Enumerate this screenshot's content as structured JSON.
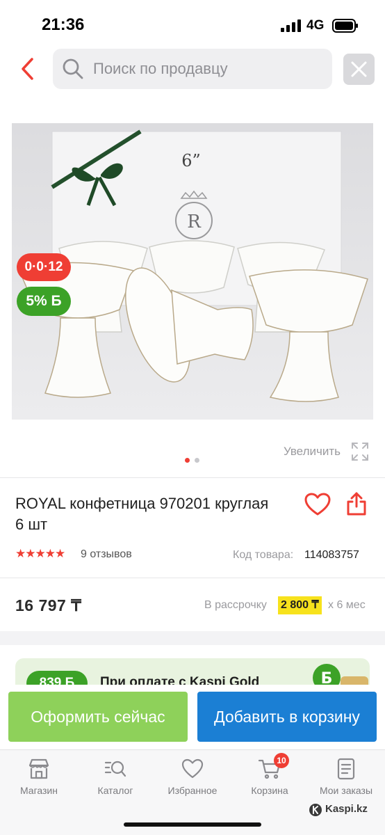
{
  "status_bar": {
    "time": "21:36",
    "network": "4G"
  },
  "search": {
    "placeholder": "Поиск по продавцу"
  },
  "product": {
    "badge_installment": "0·0·12",
    "badge_bonus": "5% Б",
    "image_pagination": {
      "current": 1,
      "total": 2
    },
    "zoom_label": "Увеличить",
    "title": "ROYAL конфетница 970201 круглая 6 шт",
    "rating_stars": 5,
    "reviews": "9 отзывов",
    "sku_label": "Код товара:",
    "sku_value": "114083757",
    "price": "16 797 ₸",
    "installment_label": "В рассрочку",
    "installment_amount": "2 800 ₸",
    "installment_term": "х 6 мес",
    "image_text": "6”",
    "logo_letter": "R"
  },
  "promo": {
    "badge": "839 Б",
    "text": "При оплате с Kaspi Gold"
  },
  "actions": {
    "buy_now": "Оформить сейчас",
    "add_to_cart": "Добавить в корзину"
  },
  "nav": {
    "items": [
      {
        "label": "Магазин",
        "icon": "store-icon"
      },
      {
        "label": "Каталог",
        "icon": "catalog-search-icon"
      },
      {
        "label": "Избранное",
        "icon": "heart-icon"
      },
      {
        "label": "Корзина",
        "icon": "cart-icon"
      },
      {
        "label": "Мои заказы",
        "icon": "orders-icon"
      }
    ],
    "cart_count": "10"
  },
  "watermark": "Kaspi.kz",
  "colors": {
    "accent": "#ef3e34",
    "bonus_green": "#3ca227",
    "buy_button": "#8ed15a",
    "cart_button": "#1b7fd4",
    "installment_highlight": "#f7e21c"
  }
}
